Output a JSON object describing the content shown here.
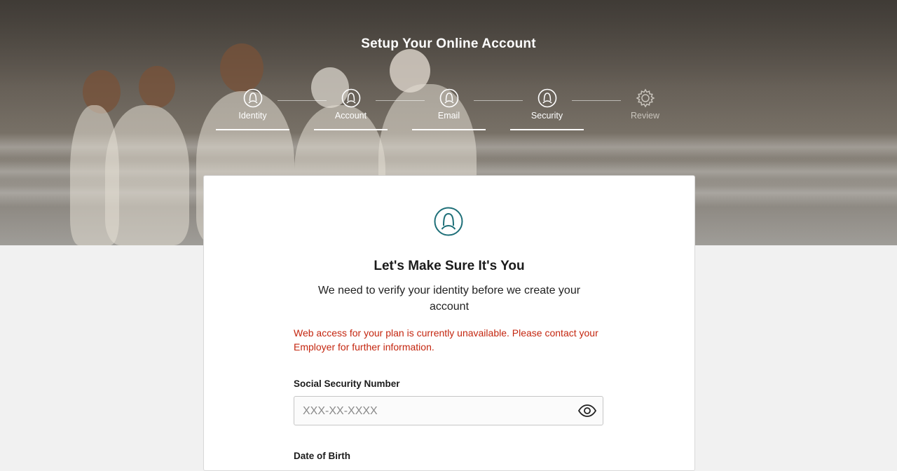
{
  "header": {
    "title": "Setup Your Online Account"
  },
  "steps": [
    {
      "label": "Identity",
      "icon": "user-icon",
      "state": "active"
    },
    {
      "label": "Account",
      "icon": "user-icon",
      "state": "active"
    },
    {
      "label": "Email",
      "icon": "user-icon",
      "state": "active"
    },
    {
      "label": "Security",
      "icon": "user-icon",
      "state": "active"
    },
    {
      "label": "Review",
      "icon": "gear-icon",
      "state": "inactive"
    }
  ],
  "card": {
    "icon": "user-icon",
    "heading": "Let's Make Sure It's You",
    "subheading": "We need to verify your identity before we create your account",
    "error": "Web access for your plan is currently unavailable. Please contact your Employer for further information.",
    "ssn": {
      "label": "Social Security Number",
      "placeholder": "XXX-XX-XXXX",
      "value": "",
      "toggle_icon": "eye-icon"
    },
    "dob": {
      "label": "Date of Birth"
    }
  },
  "colors": {
    "accent": "#1e6f78",
    "error": "#c4260f",
    "inactive_step": "#c9c4bc"
  }
}
